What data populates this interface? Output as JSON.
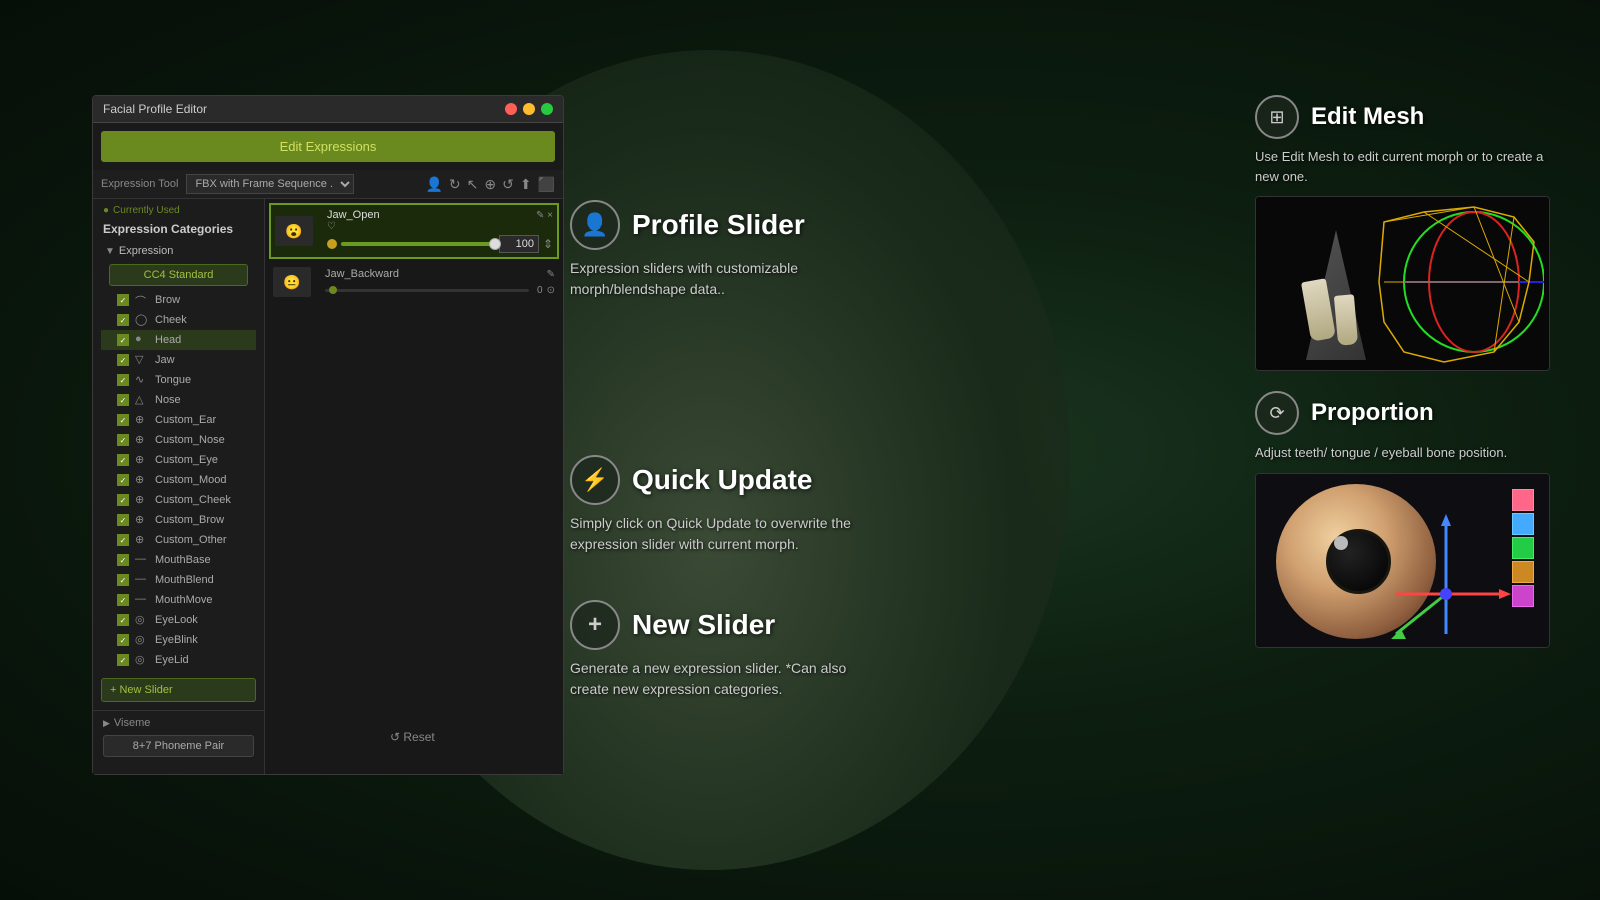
{
  "app": {
    "title": "Facial Profile Editor",
    "background_color": "#0a1a0e"
  },
  "panel": {
    "title": "Facial Profile Editor",
    "close_btn": "✕",
    "edit_expressions_label": "Edit Expressions",
    "toolbar": {
      "expression_tool_label": "Expression Tool",
      "fbx_option": "FBX with Frame Sequence .",
      "icons": [
        "👤",
        "↻",
        "⌫",
        "⊕",
        "↺",
        "⬆",
        "⬛"
      ]
    },
    "categories": {
      "currently_used": "Currently Used",
      "header": "Expression Categories",
      "tree_label": "Expression",
      "preset_label": "CC4 Standard",
      "items": [
        {
          "label": "Brow",
          "checked": true
        },
        {
          "label": "Cheek",
          "checked": true
        },
        {
          "label": "Head",
          "checked": true
        },
        {
          "label": "Jaw",
          "checked": true
        },
        {
          "label": "Tongue",
          "checked": true
        },
        {
          "label": "Nose",
          "checked": true
        },
        {
          "label": "Custom_Ear",
          "checked": true
        },
        {
          "label": "Custom_Nose",
          "checked": true
        },
        {
          "label": "Custom_Eye",
          "checked": true
        },
        {
          "label": "Custom_Mood",
          "checked": true
        },
        {
          "label": "Custom_Cheek",
          "checked": true
        },
        {
          "label": "Custom_Brow",
          "checked": true
        },
        {
          "label": "Custom_Other",
          "checked": true
        },
        {
          "label": "MouthBase",
          "checked": true
        },
        {
          "label": "MouthBlend",
          "checked": true
        },
        {
          "label": "MouthMove",
          "checked": true
        },
        {
          "label": "EyeLook",
          "checked": true
        },
        {
          "label": "EyeBlink",
          "checked": true
        },
        {
          "label": "EyeLid",
          "checked": true
        }
      ],
      "new_slider_label": "+ New Slider",
      "viseme_label": "Viseme",
      "phoneme_btn_label": "8+7 Phoneme Pair"
    }
  },
  "expression_list": {
    "items": [
      {
        "name": "Jaw_Open",
        "value": 100,
        "highlighted": true
      },
      {
        "name": "Jaw_Backward",
        "value": 0,
        "highlighted": false
      }
    ]
  },
  "callouts": {
    "profile_slider": {
      "icon": "👤",
      "title": "Profile Slider",
      "description": "Expression sliders with customizable morph/blendshape data.."
    },
    "quick_update": {
      "icon": "⚡",
      "title": "Quick Update",
      "description": "Simply click on Quick Update to overwrite the expression slider with current morph."
    },
    "new_slider": {
      "icon": "+",
      "title": "New Slider",
      "description": "Generate a new expression slider.\n*Can also create new expression categories."
    }
  },
  "features": {
    "edit_mesh": {
      "icon": "⊞",
      "title": "Edit Mesh",
      "description": "Use Edit Mesh to edit current morph or to create a new one."
    },
    "proportion": {
      "icon": "⟳",
      "title": "Proportion",
      "description": "Adjust teeth/ tongue / eyeball bone position."
    }
  },
  "reset_label": "↺ Reset"
}
